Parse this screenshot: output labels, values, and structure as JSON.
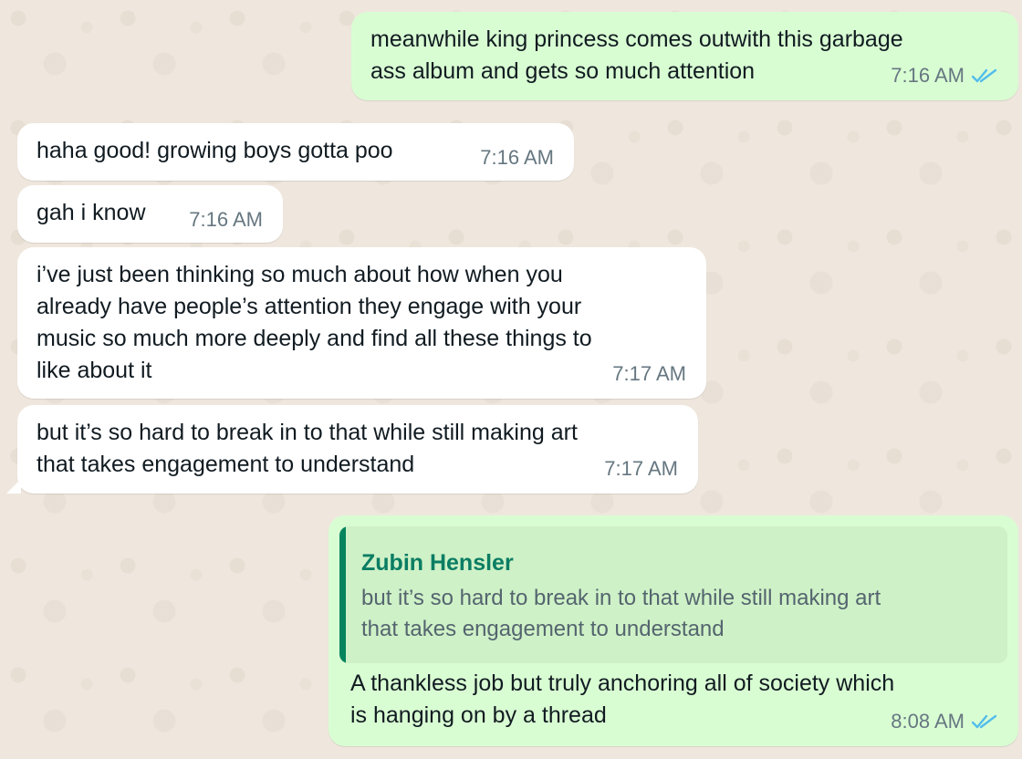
{
  "messages": [
    {
      "direction": "outgoing",
      "text": "meanwhile king princess comes outwith this garbage\nass album and gets so much attention",
      "time": "7:16 AM",
      "status_icon": "double-check-icon"
    },
    {
      "direction": "incoming",
      "text": "haha good! growing boys gotta poo",
      "time": "7:16 AM"
    },
    {
      "direction": "incoming",
      "text": "gah i know",
      "time": "7:16 AM"
    },
    {
      "direction": "incoming",
      "text": "i’ve just been thinking so much about how when you\nalready have people’s attention they engage with your\nmusic so much more deeply and find all these things to\nlike about it",
      "time": "7:17 AM"
    },
    {
      "direction": "incoming",
      "text": "but it’s so hard to break in to that while still making art\nthat takes engagement to understand",
      "time": "7:17 AM"
    },
    {
      "direction": "outgoing",
      "quote": {
        "author": "Zubin Hensler",
        "text": "but it’s so hard to break in to that while still making art\nthat takes engagement to understand"
      },
      "text": "A thankless job but truly anchoring all of society which\nis hanging on by a thread",
      "time": "8:08 AM",
      "status_icon": "double-check-icon"
    }
  ],
  "colors": {
    "background": "#efe7dd",
    "incoming_bubble": "#ffffff",
    "outgoing_bubble": "#d9fdd3",
    "quote_background": "#cff1c7",
    "quote_accent": "#06845d",
    "quote_name": "#0a7d63",
    "read_receipt": "#53bdeb",
    "timestamp": "#667781"
  }
}
